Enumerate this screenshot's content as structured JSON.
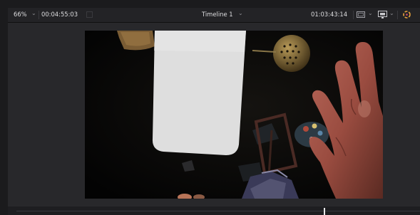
{
  "toolbar": {
    "zoom_level": "66%",
    "duration_timecode": "00:04:55:03",
    "timeline_name": "Timeline 1",
    "current_timecode": "01:03:43:14"
  },
  "icons": {
    "zoom_dropdown": "chevron-down-icon",
    "timeline_dropdown": "chevron-down-icon",
    "viewer_layout": "viewer-layout-icon",
    "output_display": "display-icon",
    "color_picker": "color-wheel-icon"
  },
  "colors": {
    "accent_icon": "#e8a33c",
    "background": "#1b1b1d",
    "toolbar": "#232326",
    "viewer": "#28282b"
  }
}
